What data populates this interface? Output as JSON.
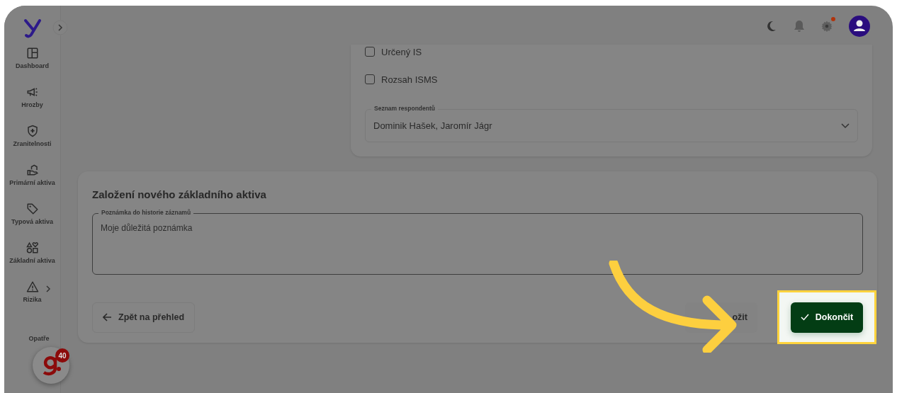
{
  "sidebar": {
    "items": [
      {
        "label": "Dashboard",
        "has_children": false
      },
      {
        "label": "Hrozby",
        "has_children": false
      },
      {
        "label": "Zranitelnosti",
        "has_children": false
      },
      {
        "label": "Primární aktiva",
        "has_children": false
      },
      {
        "label": "Typová aktiva",
        "has_children": false
      },
      {
        "label": "Základní aktiva",
        "has_children": false
      },
      {
        "label": "Rizika",
        "has_children": true
      },
      {
        "label": "Opatře",
        "has_children": false
      }
    ]
  },
  "topbar": {
    "notification_dot": true
  },
  "checkboxes": [
    {
      "label": "Určený IS",
      "checked": false
    },
    {
      "label": "Rozsah ISMS",
      "checked": false
    }
  ],
  "respondents": {
    "label": "Seznam respondentů",
    "value": "Dominik Hašek, Jaromír Jágr"
  },
  "section": {
    "title": "Založení nového základního aktiva",
    "note": {
      "label": "Poznámka do historie záznamů",
      "value": "Moje důležitá poznámka"
    },
    "back_button": "Zpět na přehled",
    "save_button": "ožit",
    "finish_button": "Dokončit"
  },
  "badge": {
    "count": "40"
  }
}
